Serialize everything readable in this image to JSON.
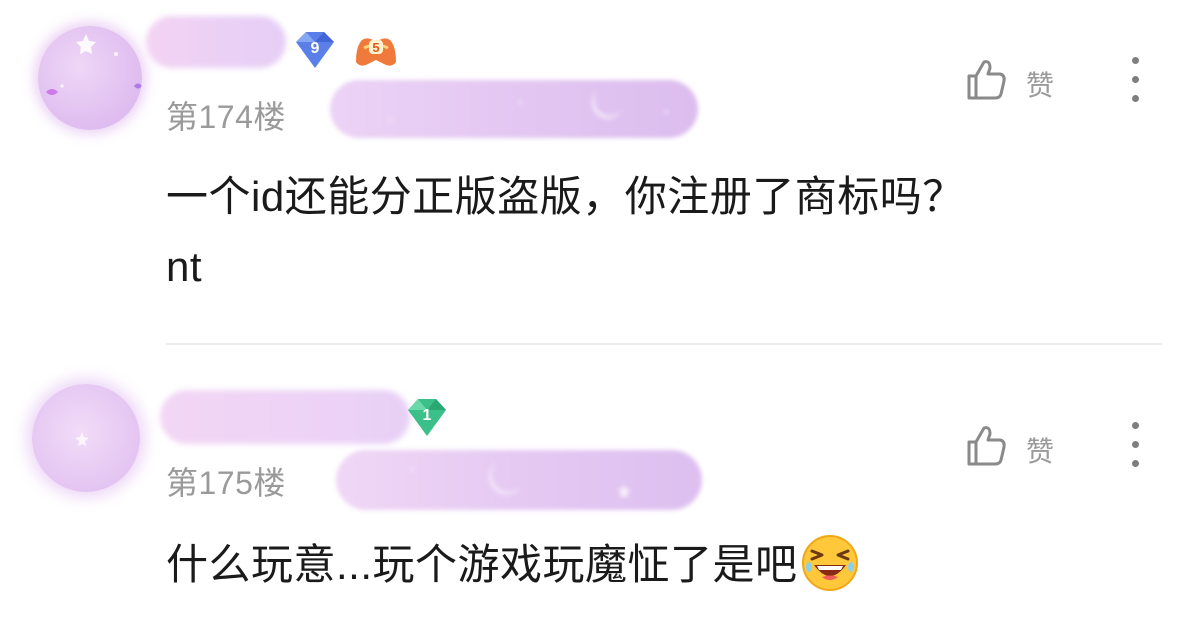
{
  "comments": [
    {
      "floor": "第174楼",
      "level_badge": "9",
      "medal_badge": "5",
      "like_label": "赞",
      "text": "一个id还能分正版盗版，你注册了商标吗？\nnt",
      "icons": [
        "thumbs-up-icon",
        "more-vertical-icon"
      ]
    },
    {
      "floor": "第175楼",
      "level_badge": "1",
      "like_label": "赞",
      "text": "什么玩意...玩个游戏玩魔怔了是吧",
      "emoji": "laughing-face-emoji",
      "icons": [
        "thumbs-up-icon",
        "more-vertical-icon"
      ]
    }
  ],
  "colors": {
    "text_primary": "#1a1a1a",
    "text_secondary": "#9a9a9a",
    "level9_badge": "#5a7fe8",
    "level1_badge": "#3cc08a",
    "medal_badge": "#f07a3c",
    "censor_blur": "#e6c8f3",
    "divider": "#ededed"
  }
}
